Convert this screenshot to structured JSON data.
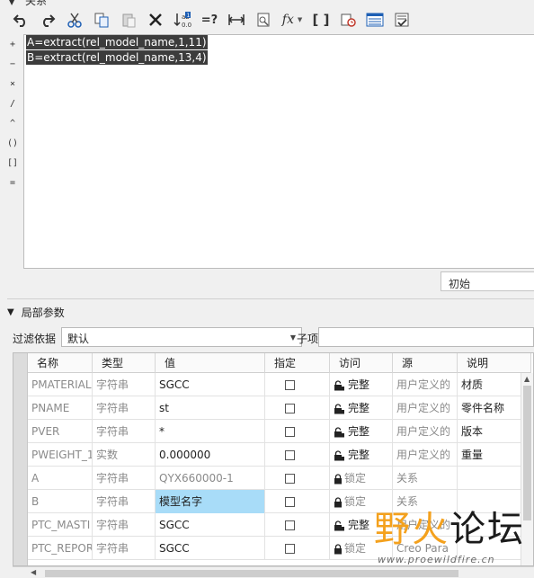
{
  "header": {
    "title_cut": "关系"
  },
  "toolbar": {
    "buttons": [
      {
        "name": "undo-icon"
      },
      {
        "name": "redo-icon"
      },
      {
        "name": "cut-icon"
      },
      {
        "name": "copy-icon"
      },
      {
        "name": "paste-icon"
      },
      {
        "name": "delete-icon"
      },
      {
        "name": "sort-relations-icon"
      },
      {
        "name": "evaluate-icon",
        "label": "=?"
      },
      {
        "name": "measure-icon"
      },
      {
        "name": "show-dimension-icon"
      },
      {
        "name": "function-icon",
        "label": "fx"
      },
      {
        "name": "parameters-icon",
        "label": "[ ]"
      },
      {
        "name": "unit-sensitive-icon"
      },
      {
        "name": "local-params-icon"
      },
      {
        "name": "verify-icon"
      }
    ]
  },
  "operators": [
    "+",
    "−",
    "×",
    "/",
    "^",
    "()",
    "[]",
    "="
  ],
  "editor": {
    "lines": [
      "A=extract(rel_model_name,1,11)",
      "B=extract(rel_model_name,13,4)"
    ]
  },
  "state_select": {
    "value": "初始"
  },
  "local_params": {
    "title": "局部参数",
    "filter_label": "过滤依据",
    "filter_value": "默认",
    "sub_label": "子项",
    "columns": [
      "名称",
      "类型",
      "值",
      "指定",
      "访问",
      "源",
      "说明"
    ],
    "rows": [
      {
        "name": "PMATERIAL",
        "type": "字符串",
        "value": "SGCC",
        "access": "完整",
        "source": "用户定义的",
        "desc": "材质",
        "value_style": "dark",
        "highlight": false
      },
      {
        "name": "PNAME",
        "type": "字符串",
        "value": "st",
        "access": "完整",
        "source": "用户定义的",
        "desc": "零件名称",
        "value_style": "dark",
        "highlight": false
      },
      {
        "name": "PVER",
        "type": "字符串",
        "value": "*",
        "access": "完整",
        "source": "用户定义的",
        "desc": "版本",
        "value_style": "dark",
        "highlight": false
      },
      {
        "name": "PWEIGHT_1",
        "type": "实数",
        "value": "0.000000",
        "access": "完整",
        "source": "用户定义的",
        "desc": "重量",
        "value_style": "dark",
        "highlight": false
      },
      {
        "name": "A",
        "type": "字符串",
        "value": "QYX660000-1",
        "access": "锁定",
        "source": "关系",
        "desc": "",
        "value_style": "muted",
        "highlight": false
      },
      {
        "name": "B",
        "type": "字符串",
        "value": "模型名字",
        "access": "锁定",
        "source": "关系",
        "desc": "",
        "value_style": "dark",
        "highlight": true
      },
      {
        "name": "PTC_MASTI",
        "type": "字符串",
        "value": "SGCC",
        "access": "完整",
        "source": "用户定义的",
        "desc": "",
        "value_style": "dark",
        "highlight": false
      },
      {
        "name": "PTC_REPOR",
        "type": "字符串",
        "value": "SGCC",
        "access": "锁定",
        "source": "Creo Para",
        "desc": "",
        "value_style": "dark",
        "highlight": false
      }
    ]
  },
  "watermark": {
    "brand": "野火论坛",
    "url": "www.proewildfire.cn"
  }
}
